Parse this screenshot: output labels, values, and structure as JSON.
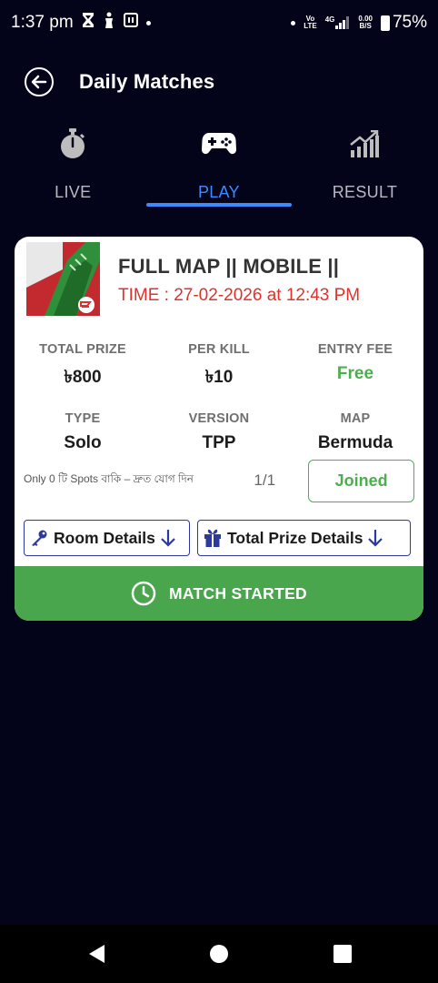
{
  "status_bar": {
    "time": "1:37 pm",
    "network_top": "Vo",
    "network_bottom": "LTE",
    "net_type": "4G",
    "speed_top": "0.00",
    "speed_bottom": "B/S",
    "battery": "75%",
    "icons": [
      "hourglass-icon",
      "figure-icon",
      "nfc-icon",
      "dot-icon",
      "signal-icon",
      "battery-icon"
    ]
  },
  "appbar": {
    "title": "Daily Matches",
    "back_icon": "back-arrow-circle-icon"
  },
  "tabs": [
    {
      "label": "LIVE",
      "icon": "stopwatch-icon",
      "active": false
    },
    {
      "label": "PLAY",
      "icon": "gamepad-icon",
      "active": true
    },
    {
      "label": "RESULT",
      "icon": "chart-growth-icon",
      "active": false
    }
  ],
  "match": {
    "title": "FULL MAP || MOBILE ||",
    "time": "TIME : 27-02-2026 at 12:43 PM",
    "stats": [
      {
        "label": "TOTAL PRIZE",
        "value": "৳800"
      },
      {
        "label": "PER KILL",
        "value": "৳10"
      },
      {
        "label": "ENTRY FEE",
        "value": "Free"
      },
      {
        "label": "TYPE",
        "value": "Solo"
      },
      {
        "label": "VERSION",
        "value": "TPP"
      },
      {
        "label": "MAP",
        "value": "Bermuda"
      }
    ],
    "spots_text": "Only 0 টি Spots বাকি – দ্রুত যোগ দিন",
    "spots_count": "1/1",
    "joined_label": "Joined",
    "room_details_label": "Room Details",
    "total_prize_details_label": "Total Prize Details",
    "status_label": "MATCH STARTED"
  },
  "colors": {
    "background": "#03031a",
    "accent": "#3b8bff",
    "green": "#4aa64c",
    "red": "#e0322b",
    "border_blue": "#2c3a9e"
  }
}
